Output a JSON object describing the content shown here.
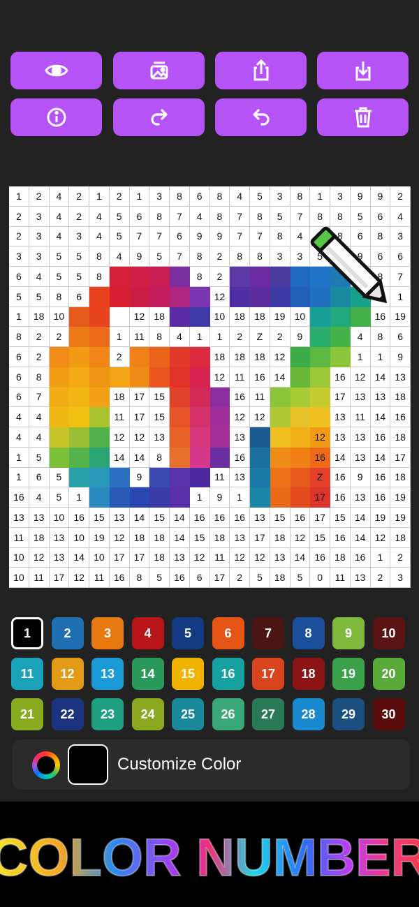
{
  "toolbar": {
    "buttons": [
      {
        "icon": "eye-icon",
        "name": "preview-button"
      },
      {
        "icon": "gallery-icon",
        "name": "gallery-button"
      },
      {
        "icon": "share-icon",
        "name": "share-button"
      },
      {
        "icon": "download-icon",
        "name": "download-button"
      },
      {
        "icon": "info-icon",
        "name": "info-button"
      },
      {
        "icon": "redo-icon",
        "name": "redo-button"
      },
      {
        "icon": "undo-icon",
        "name": "undo-button"
      },
      {
        "icon": "trash-icon",
        "name": "delete-button"
      }
    ],
    "accent": "#b653f7"
  },
  "grid": {
    "rows": [
      [
        "1",
        "2",
        "4",
        "2",
        "1",
        "2",
        "1",
        "3",
        "8",
        "6",
        "8",
        "4",
        "5",
        "3",
        "8",
        "1",
        "3",
        "9",
        "9",
        "2"
      ],
      [
        "2",
        "3",
        "4",
        "2",
        "4",
        "5",
        "6",
        "8",
        "7",
        "4",
        "8",
        "7",
        "8",
        "5",
        "7",
        "8",
        "8",
        "5",
        "6",
        "4"
      ],
      [
        "2",
        "3",
        "4",
        "3",
        "4",
        "5",
        "7",
        "7",
        "6",
        "9",
        "9",
        "7",
        "7",
        "8",
        "4",
        "5",
        "8",
        "6",
        "8",
        "3"
      ],
      [
        "3",
        "3",
        "5",
        "5",
        "8",
        "4",
        "9",
        "5",
        "7",
        "8",
        "2",
        "8",
        "8",
        "3",
        "3",
        "5",
        "9",
        "9",
        "6",
        "6"
      ],
      [
        "6",
        "4",
        "5",
        "5",
        "8",
        "",
        "",
        "",
        "",
        "8",
        "2",
        "",
        "",
        "",
        "",
        "",
        "",
        "",
        "8",
        "7"
      ],
      [
        "5",
        "5",
        "8",
        "6",
        "",
        "",
        "",
        "",
        "",
        "",
        "12",
        "",
        "",
        "",
        "",
        "",
        "",
        "",
        "3",
        "1"
      ],
      [
        "1",
        "18",
        "10",
        "",
        "",
        "",
        "12",
        "18",
        "",
        "",
        "10",
        "18",
        "18",
        "19",
        "10",
        "",
        "",
        "",
        "16",
        "19"
      ],
      [
        "8",
        "2",
        "2",
        "",
        "",
        "1",
        "11",
        "8",
        "4",
        "1",
        "1",
        "2",
        "Z",
        "2",
        "9",
        "",
        "",
        "4",
        "8",
        "6"
      ],
      [
        "6",
        "2",
        "",
        "",
        "",
        "2",
        "",
        "",
        "",
        "",
        "18",
        "18",
        "18",
        "12",
        "",
        "",
        "",
        "1",
        "1",
        "9"
      ],
      [
        "6",
        "8",
        "",
        "",
        "",
        "",
        "",
        "",
        "",
        "",
        "12",
        "11",
        "16",
        "14",
        "",
        "",
        "16",
        "12",
        "14",
        "13"
      ],
      [
        "6",
        "7",
        "",
        "",
        "",
        "18",
        "17",
        "15",
        "",
        "",
        "",
        "16",
        "11",
        "",
        "",
        "",
        "17",
        "13",
        "13",
        "18"
      ],
      [
        "4",
        "4",
        "",
        "",
        "",
        "11",
        "17",
        "15",
        "",
        "",
        "",
        "12",
        "12",
        "",
        "",
        "",
        "13",
        "11",
        "14",
        "16"
      ],
      [
        "4",
        "4",
        "",
        "",
        "",
        "12",
        "12",
        "13",
        "",
        "",
        "",
        "13",
        "",
        "",
        "",
        "12",
        "13",
        "13",
        "16",
        "18"
      ],
      [
        "1",
        "5",
        "",
        "",
        "",
        "14",
        "14",
        "8",
        "",
        "",
        "",
        "16",
        "",
        "",
        "",
        "16",
        "14",
        "13",
        "14",
        "17"
      ],
      [
        "1",
        "6",
        "5",
        "",
        "",
        "",
        "9",
        "",
        "",
        "",
        "11",
        "13",
        "",
        "",
        "",
        "Z",
        "16",
        "9",
        "16",
        "18"
      ],
      [
        "16",
        "4",
        "5",
        "1",
        "",
        "",
        "",
        "",
        "",
        "1",
        "9",
        "1",
        "",
        "",
        "",
        "17",
        "16",
        "13",
        "16",
        "19"
      ],
      [
        "13",
        "13",
        "10",
        "16",
        "15",
        "13",
        "14",
        "15",
        "14",
        "16",
        "16",
        "16",
        "13",
        "15",
        "16",
        "17",
        "15",
        "14",
        "19",
        "19"
      ],
      [
        "11",
        "18",
        "13",
        "10",
        "19",
        "12",
        "18",
        "18",
        "14",
        "15",
        "18",
        "13",
        "17",
        "18",
        "12",
        "15",
        "16",
        "14",
        "12",
        "18"
      ],
      [
        "10",
        "12",
        "13",
        "14",
        "10",
        "17",
        "17",
        "18",
        "13",
        "12",
        "11",
        "12",
        "12",
        "13",
        "14",
        "16",
        "18",
        "16",
        "1",
        "2"
      ],
      [
        "10",
        "11",
        "17",
        "12",
        "11",
        "16",
        "8",
        "5",
        "16",
        "6",
        "17",
        "2",
        "5",
        "18",
        "5",
        "0",
        "11",
        "13",
        "2",
        "3"
      ]
    ],
    "colors": [
      [
        null,
        null,
        null,
        null,
        null,
        null,
        null,
        null,
        null,
        null,
        null,
        null,
        null,
        null,
        null,
        null,
        null,
        null,
        null,
        null
      ],
      [
        null,
        null,
        null,
        null,
        null,
        null,
        null,
        null,
        null,
        null,
        null,
        null,
        null,
        null,
        null,
        null,
        null,
        null,
        null,
        null
      ],
      [
        null,
        null,
        null,
        null,
        null,
        null,
        null,
        null,
        null,
        null,
        null,
        null,
        null,
        null,
        null,
        null,
        null,
        null,
        null,
        null
      ],
      [
        null,
        null,
        null,
        null,
        null,
        null,
        null,
        null,
        null,
        null,
        null,
        null,
        null,
        null,
        null,
        null,
        null,
        null,
        null,
        null
      ],
      [
        null,
        null,
        null,
        null,
        null,
        "#d6203a",
        "#d01e48",
        "#c81d55",
        "#7b2e9f",
        null,
        null,
        "#5b3aa5",
        "#6a2aa0",
        "#4a3a9e",
        "#1f6ac0",
        "#1f74c8",
        "#1e7ab0",
        null,
        null,
        null
      ],
      [
        null,
        null,
        null,
        null,
        "#e8401f",
        "#d81e32",
        "#cc1e44",
        "#c41d5e",
        "#b0267e",
        "#7b34b0",
        null,
        "#4e2ea4",
        "#5a2c9c",
        "#3a3aa2",
        "#2060b8",
        "#2070c0",
        "#1a8aa0",
        "#17a08a",
        null,
        null
      ],
      [
        null,
        null,
        null,
        "#e65a1c",
        "#e8441e",
        null,
        null,
        null,
        "#5b2aa5",
        "#3f3aa8",
        null,
        null,
        null,
        null,
        null,
        "#18a098",
        "#21a87c",
        "#43b04a",
        null,
        null
      ],
      [
        null,
        null,
        null,
        "#ef7a18",
        "#ec6a1a",
        null,
        null,
        null,
        null,
        null,
        null,
        null,
        null,
        null,
        null,
        "#2aae6e",
        "#46b24c",
        null,
        null,
        null
      ],
      [
        null,
        null,
        "#f08c17",
        "#f29a16",
        "#ef8418",
        null,
        "#f0801a",
        "#ea641c",
        "#e23a2a",
        "#dc2a3e",
        null,
        null,
        null,
        null,
        "#3cac48",
        "#5cb83e",
        "#8cc43a",
        null,
        null,
        null
      ],
      [
        null,
        null,
        "#f29e15",
        "#f4aa14",
        "#f09416",
        "#f2a414",
        "#ef8c18",
        "#e8561e",
        "#e2302a",
        "#d82450",
        null,
        null,
        null,
        null,
        "#6ab83a",
        "#9ac838",
        null,
        null,
        null,
        null
      ],
      [
        null,
        null,
        "#f2ac14",
        "#f4b614",
        "#f2a016",
        null,
        null,
        null,
        "#e0422a",
        "#d42a5a",
        "#8a2ea0",
        null,
        null,
        "#8cc43a",
        "#a8cc36",
        "#c4cc30",
        null,
        null,
        null,
        null
      ],
      [
        null,
        null,
        "#f0b814",
        "#f4c014",
        "#aac22e",
        null,
        null,
        null,
        "#e45428",
        "#d4306a",
        "#a02e9a",
        null,
        null,
        "#b0c834",
        "#e8c22a",
        "#f0c020",
        null,
        null,
        null,
        null
      ],
      [
        null,
        null,
        "#c4c428",
        "#9cbe34",
        "#52b04c",
        null,
        null,
        null,
        "#e86226",
        "#d8367a",
        "#a22e98",
        null,
        "#1a5a90",
        "#f0c020",
        "#f2b018",
        "#f09a16",
        null,
        null,
        null,
        null
      ],
      [
        null,
        null,
        "#7cc03a",
        "#56b24a",
        "#2aa474",
        null,
        null,
        null,
        "#e8702a",
        "#d6388c",
        "#6a2ea0",
        null,
        "#1a6ea0",
        "#ef8c18",
        "#ef8016",
        "#ec6a1a",
        null,
        null,
        null,
        null
      ],
      [
        null,
        null,
        null,
        "#2aa0a8",
        "#2898b8",
        "#2a70c0",
        null,
        "#3a48b0",
        "#5a32a8",
        "#4a2a9e",
        null,
        null,
        "#1b7aa8",
        "#ec7218",
        "#e85a1c",
        "#e4402a",
        null,
        null,
        null,
        null
      ],
      [
        null,
        null,
        null,
        null,
        "#2a8ac0",
        "#2a5ab8",
        "#2a46b0",
        "#3a3aa8",
        "#5a2ea8",
        null,
        null,
        null,
        "#1a86a8",
        "#ea6a1c",
        "#e44c20",
        "#dc342a",
        null,
        null,
        null,
        null
      ],
      [
        null,
        null,
        null,
        null,
        null,
        null,
        null,
        null,
        null,
        null,
        null,
        null,
        null,
        null,
        null,
        null,
        null,
        null,
        null,
        null
      ],
      [
        null,
        null,
        null,
        null,
        null,
        null,
        null,
        null,
        null,
        null,
        null,
        null,
        null,
        null,
        null,
        null,
        null,
        null,
        null,
        null
      ],
      [
        null,
        null,
        null,
        null,
        null,
        null,
        null,
        null,
        null,
        null,
        null,
        null,
        null,
        null,
        null,
        null,
        null,
        null,
        null,
        null
      ],
      [
        null,
        null,
        null,
        null,
        null,
        null,
        null,
        null,
        null,
        null,
        null,
        null,
        null,
        null,
        null,
        null,
        null,
        null,
        null,
        null
      ]
    ]
  },
  "palette": [
    {
      "label": "1",
      "color": "#000000",
      "selected": true
    },
    {
      "label": "2",
      "color": "#1f6fb3"
    },
    {
      "label": "3",
      "color": "#e8790f"
    },
    {
      "label": "4",
      "color": "#b8141a"
    },
    {
      "label": "5",
      "color": "#143a82"
    },
    {
      "label": "6",
      "color": "#e55516"
    },
    {
      "label": "7",
      "color": "#4a1512"
    },
    {
      "label": "8",
      "color": "#1b4f9c"
    },
    {
      "label": "9",
      "color": "#7fba3c"
    },
    {
      "label": "10",
      "color": "#5a1414"
    },
    {
      "label": "11",
      "color": "#1aa2b8"
    },
    {
      "label": "12",
      "color": "#e39a16"
    },
    {
      "label": "13",
      "color": "#1a9ad6"
    },
    {
      "label": "14",
      "color": "#2a9a5a"
    },
    {
      "label": "15",
      "color": "#f0b400"
    },
    {
      "label": "16",
      "color": "#17a0a0"
    },
    {
      "label": "17",
      "color": "#d9431e"
    },
    {
      "label": "18",
      "color": "#8c1414"
    },
    {
      "label": "19",
      "color": "#3aa04a"
    },
    {
      "label": "20",
      "color": "#5aaa3a"
    },
    {
      "label": "21",
      "color": "#8aaa20"
    },
    {
      "label": "22",
      "color": "#1a3480"
    },
    {
      "label": "23",
      "color": "#1fa080"
    },
    {
      "label": "24",
      "color": "#8ca820"
    },
    {
      "label": "25",
      "color": "#1a8a9a"
    },
    {
      "label": "26",
      "color": "#3aa87a"
    },
    {
      "label": "27",
      "color": "#2a7a5a"
    },
    {
      "label": "28",
      "color": "#1a8ad0"
    },
    {
      "label": "29",
      "color": "#1a4f80"
    },
    {
      "label": "30",
      "color": "#5a0c0c"
    }
  ],
  "customize": {
    "label": "Customize Color",
    "current_color": "#000000"
  },
  "banner": {
    "title": "COLOR NUMBER"
  }
}
